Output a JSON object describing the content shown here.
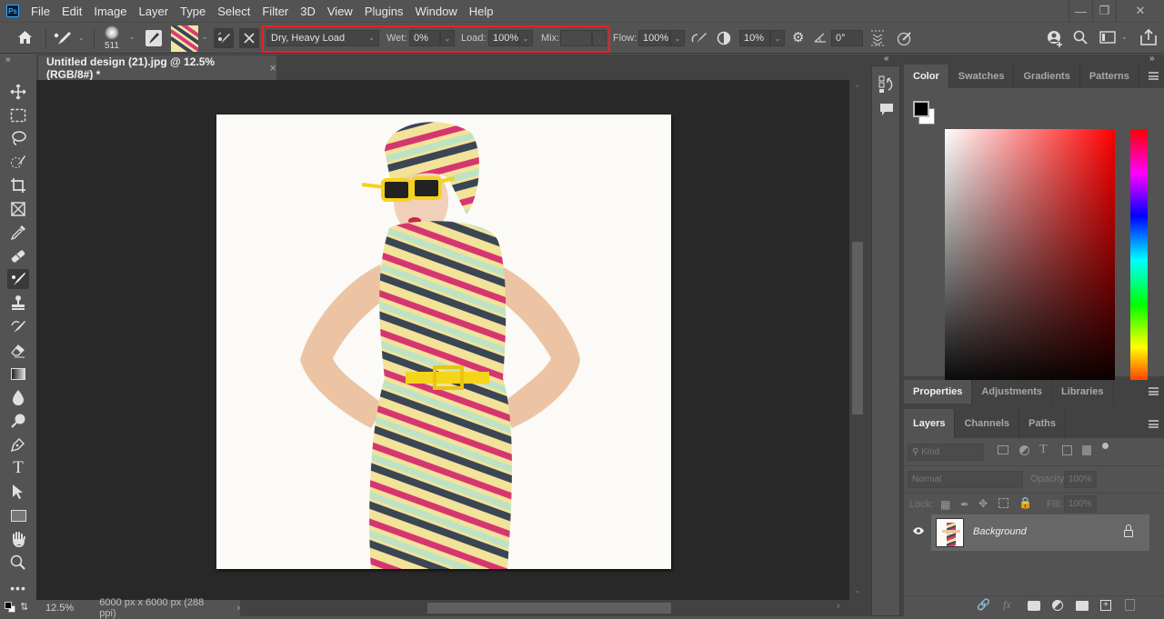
{
  "app": {
    "logo": "Ps",
    "menu": [
      "File",
      "Edit",
      "Image",
      "Layer",
      "Type",
      "Select",
      "Filter",
      "3D",
      "View",
      "Plugins",
      "Window",
      "Help"
    ],
    "window_controls": {
      "minimize": "—",
      "restore": "❐",
      "close": "✕"
    }
  },
  "options_bar": {
    "brush_size": "511",
    "blend_preset": "Dry, Heavy Load",
    "wet_label": "Wet:",
    "wet_value": "0%",
    "load_label": "Load:",
    "load_value": "100%",
    "mix_label": "Mix:",
    "mix_value": "",
    "flow_label": "Flow:",
    "flow_value": "100%",
    "smoothing_value": "10%",
    "angle_value": "0°",
    "highlight_color": "#e8202a"
  },
  "document": {
    "tab_title": "Untitled design (21).jpg @ 12.5% (RGB/8#) *",
    "close": "×"
  },
  "status_bar": {
    "zoom": "12.5%",
    "doc_info": "6000 px x 6000 px (288 ppi)",
    "arrow": "›"
  },
  "color_panel": {
    "tabs": [
      "Color",
      "Swatches",
      "Gradients",
      "Patterns"
    ],
    "active_tab": "Color",
    "foreground": "#000000",
    "background": "#ffffff",
    "hue": "#ff0000"
  },
  "properties_panel": {
    "tabs": [
      "Properties",
      "Adjustments",
      "Libraries"
    ],
    "active_tab": "Properties"
  },
  "layers_panel": {
    "tabs": [
      "Layers",
      "Channels",
      "Paths"
    ],
    "active_tab": "Layers",
    "filter_placeholder": "Kind",
    "blend_mode": "Normal",
    "opacity_label": "Opacity:",
    "opacity_value": "100%",
    "lock_label": "Lock:",
    "fill_label": "Fill:",
    "fill_value": "100%",
    "layers": [
      {
        "name": "Background",
        "visible": true,
        "locked": true
      }
    ]
  },
  "dock": {
    "collapse_left": "»",
    "collapse_mid": "«",
    "collapse_right": "»"
  }
}
